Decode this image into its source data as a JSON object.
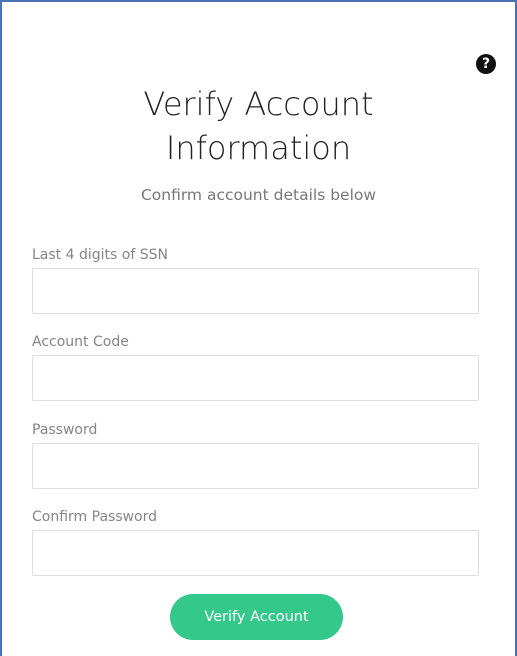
{
  "help": {
    "icon": "question-circle-icon",
    "glyph": "?"
  },
  "header": {
    "title_line1": "Verify Account",
    "title_line2": "Information",
    "subtitle": "Confirm account details below"
  },
  "form": {
    "fields": [
      {
        "label": "Last 4 digits of SSN",
        "value": "",
        "placeholder": ""
      },
      {
        "label": "Account Code",
        "value": "",
        "placeholder": ""
      },
      {
        "label": "Password",
        "value": "",
        "placeholder": ""
      },
      {
        "label": "Confirm Password",
        "value": "",
        "placeholder": ""
      }
    ],
    "submit_label": "Verify Account"
  },
  "colors": {
    "accent": "#34c98a",
    "frame_border": "#4a73b7",
    "text_dark": "#222222",
    "text_muted": "#858585"
  }
}
